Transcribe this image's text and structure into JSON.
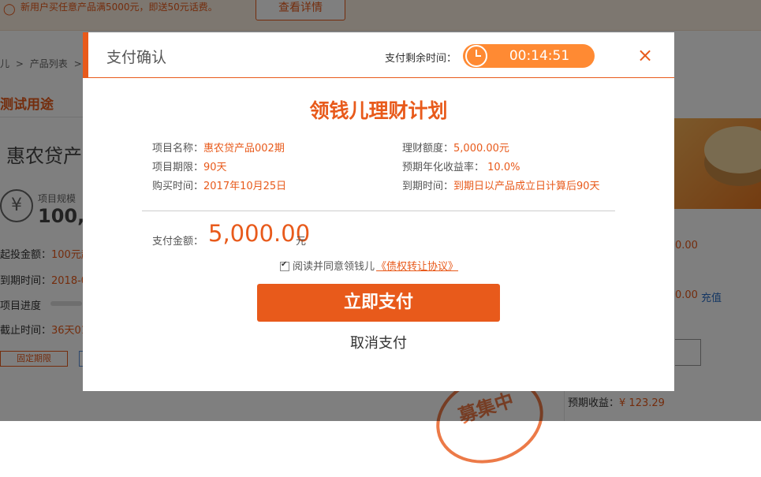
{
  "background": {
    "promo_text": "新用户买任意产品满5000元，即送50元话费。",
    "promo_button": "查看详情",
    "breadcrumb": [
      "儿",
      "产品列表",
      ">"
    ],
    "section_title": "测试用途",
    "product_name": "惠农贷产",
    "yen_symbol": "¥",
    "scale_label": "项目规模",
    "scale_value": "100,0",
    "min_invest_label": "起投金额：",
    "min_invest_value": "100元起",
    "expire_label": "到期时间：",
    "expire_value": "2018-0",
    "progress_label": "项目进度",
    "deadline_label": "截止时间：",
    "deadline_value": "36天01",
    "tag_label": "固定期限",
    "stamp_text": "募集中",
    "right_amount_1": "0.00",
    "right_amount_2": "0.00",
    "charge_link": "充值",
    "expected_label": "预期收益：",
    "expected_value": "¥ 123.29"
  },
  "modal": {
    "title": "支付确认",
    "timer_label": "支付剩余时间：",
    "timer_value": "00:14:51",
    "close_icon": "×",
    "plan_title": "领钱儿理财计划",
    "fields": {
      "project_name_label": "项目名称：",
      "project_name_value": "惠农贷产品002期",
      "amount_label": "理财额度：",
      "amount_value": "5,000.00元",
      "term_label": "项目期限：",
      "term_value": "90天",
      "rate_label": "预期年化收益率：",
      "rate_value": "10.0%",
      "buy_time_label": "购买时间：",
      "buy_time_value": "2017年10月25日",
      "due_time_label": "到期时间：",
      "due_time_value": "到期日以产品成立日计算后90天"
    },
    "pay_label": "支付金额：",
    "pay_amount": "5,000.00",
    "pay_unit": "元",
    "agree_text": "阅读并同意领钱儿",
    "agree_link": "《债权转让协议》",
    "pay_button": "立即支付",
    "cancel_button": "取消支付"
  },
  "colors": {
    "accent": "#e85a1b",
    "timer": "#ff8a33",
    "link_blue": "#2a6ec6"
  }
}
